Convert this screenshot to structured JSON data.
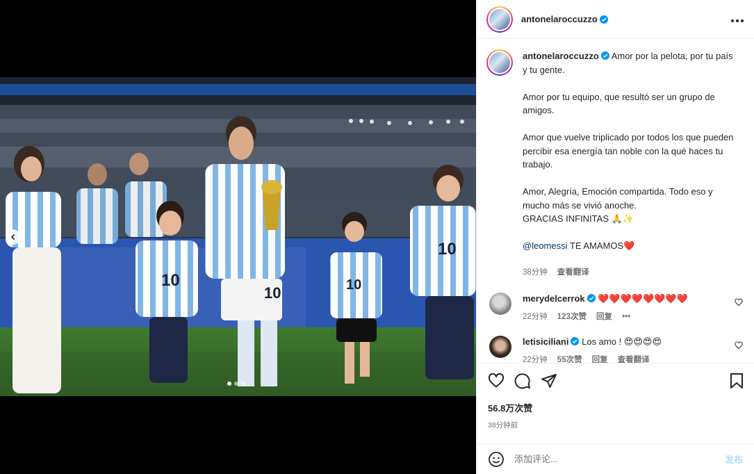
{
  "header": {
    "username": "antonelaroccuzzo"
  },
  "caption": {
    "username": "antonelaroccuzzo",
    "line1_rest": "Amor por la pelota, por tu país y tu gente.",
    "para2": "Amor por tu equipo, que resultó ser un grupo de amigos.",
    "para3": "Amor que vuelve triplicado por todos los que pueden percibir esa energía tan noble con la qué haces tu trabajo.",
    "para4_line1": "Amor, Alegría, Emoción compartida. Todo eso y mucho más se vivió anoche.",
    "para4_line2": "GRACIAS INFINITAS 🙏✨",
    "mention": "@leomessi",
    "mention_rest": " TE AMAMOS❤️",
    "time": "38分钟",
    "translate": "查看翻译"
  },
  "comments": [
    {
      "username": "merydelcerrok",
      "text": "❤️❤️❤️❤️❤️❤️❤️❤️",
      "time": "22分钟",
      "likes": "123次赞",
      "reply": "回复",
      "more": "•••"
    },
    {
      "username": "letisiciliani",
      "text": "Los amo ! 😍😍😍😍",
      "time": "22分钟",
      "likes": "55次赞",
      "reply": "回复",
      "translate": "查看翻译"
    }
  ],
  "stats": {
    "likes": "56.8万次赞",
    "ago": "38分钟前"
  },
  "composer": {
    "placeholder": "添加评论...",
    "post": "发布"
  },
  "carousel": {
    "count": 3,
    "active_index": 0
  },
  "colors": {
    "verified": "#0095f6",
    "link": "#00376b",
    "post_disabled": "#b2dffc",
    "muted": "#737373"
  },
  "icons": [
    "verified-icon",
    "more-icon",
    "chevron-left-icon",
    "heart-icon",
    "comment-icon",
    "share-icon",
    "bookmark-icon",
    "emoji-icon"
  ]
}
